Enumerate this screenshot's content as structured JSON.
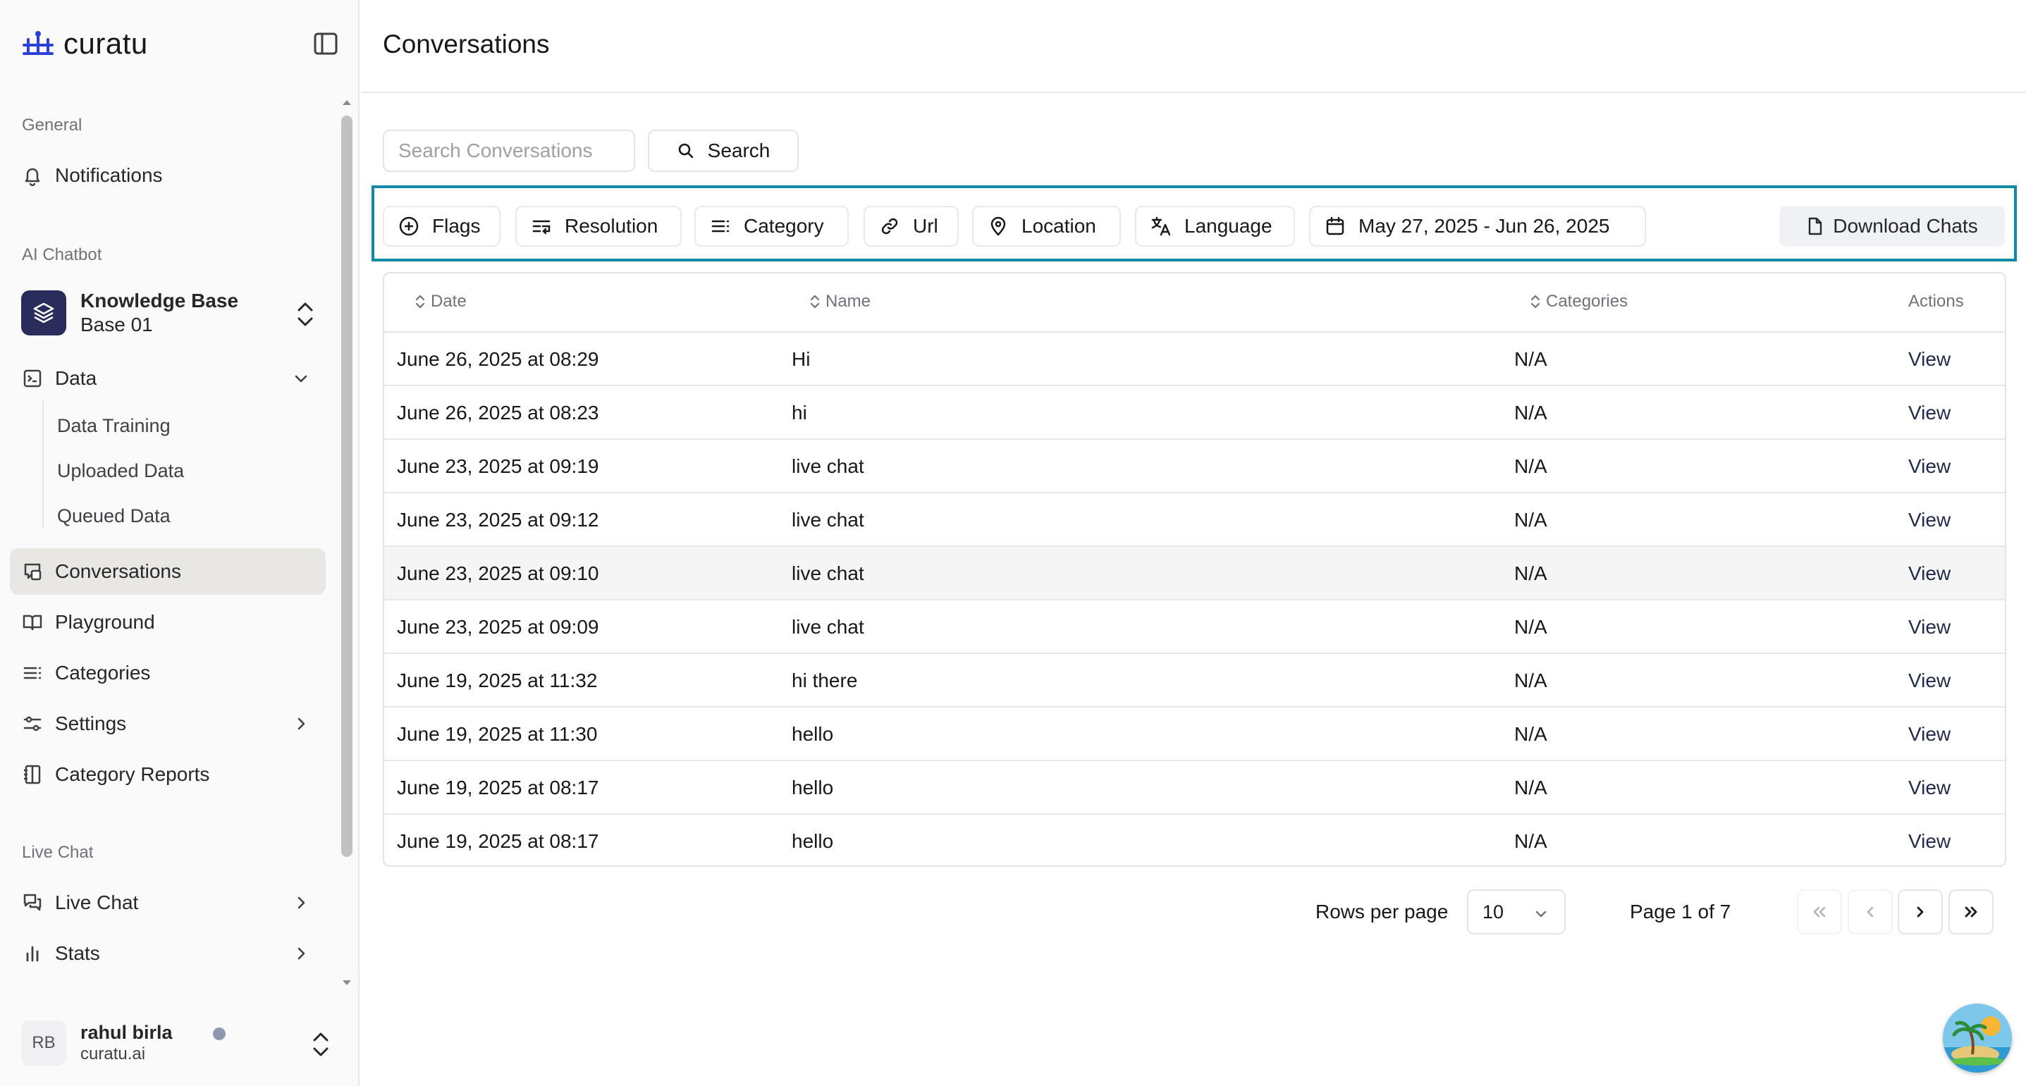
{
  "brand": {
    "name": "curatu",
    "accent": "#2c3fd6"
  },
  "sidebar": {
    "section_general": "General",
    "notifications": "Notifications",
    "section_ai": "AI Chatbot",
    "kb_title": "Knowledge Base",
    "kb_subtitle": "Base 01",
    "data": "Data",
    "data_sub": [
      "Data Training",
      "Uploaded Data",
      "Queued Data"
    ],
    "conversations": "Conversations",
    "playground": "Playground",
    "categories": "Categories",
    "settings": "Settings",
    "category_reports": "Category Reports",
    "section_live": "Live Chat",
    "live_chat": "Live Chat",
    "stats": "Stats",
    "active_item": "Conversations"
  },
  "user": {
    "initials": "RB",
    "name": "rahul birla",
    "org": "curatu.ai"
  },
  "header": {
    "title": "Conversations"
  },
  "search": {
    "placeholder": "Search Conversations",
    "button": "Search"
  },
  "filters": {
    "flags": "Flags",
    "resolution": "Resolution",
    "category": "Category",
    "url": "Url",
    "location": "Location",
    "language": "Language",
    "date_range": "May 27, 2025 - Jun 26, 2025",
    "download": "Download Chats",
    "highlight_color": "#0e8aa6"
  },
  "table": {
    "columns": {
      "date": "Date",
      "name": "Name",
      "categories": "Categories",
      "actions": "Actions"
    },
    "rows": [
      {
        "date": "June 26, 2025 at 08:29",
        "name": "Hi",
        "categories": "N/A",
        "action": "View"
      },
      {
        "date": "June 26, 2025 at 08:23",
        "name": "hi",
        "categories": "N/A",
        "action": "View"
      },
      {
        "date": "June 23, 2025 at 09:19",
        "name": "live chat",
        "categories": "N/A",
        "action": "View"
      },
      {
        "date": "June 23, 2025 at 09:12",
        "name": "live chat",
        "categories": "N/A",
        "action": "View"
      },
      {
        "date": "June 23, 2025 at 09:10",
        "name": "live chat",
        "categories": "N/A",
        "action": "View"
      },
      {
        "date": "June 23, 2025 at 09:09",
        "name": "live chat",
        "categories": "N/A",
        "action": "View"
      },
      {
        "date": "June 19, 2025 at 11:32",
        "name": "hi there",
        "categories": "N/A",
        "action": "View"
      },
      {
        "date": "June 19, 2025 at 11:30",
        "name": "hello",
        "categories": "N/A",
        "action": "View"
      },
      {
        "date": "June 19, 2025 at 08:17",
        "name": "hello",
        "categories": "N/A",
        "action": "View"
      },
      {
        "date": "June 19, 2025 at 08:17",
        "name": "hello",
        "categories": "N/A",
        "action": "View"
      }
    ]
  },
  "pagination": {
    "rows_per_page_label": "Rows per page",
    "rows_per_page": "10",
    "page_info": "Page 1 of 7"
  }
}
